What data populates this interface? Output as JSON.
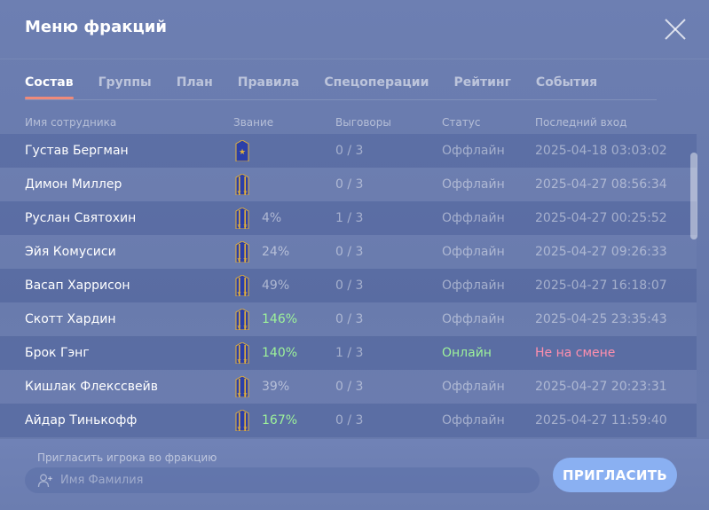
{
  "window": {
    "title": "Меню фракций"
  },
  "tabs": [
    {
      "label": "Состав",
      "active": true
    },
    {
      "label": "Группы",
      "active": false
    },
    {
      "label": "План",
      "active": false
    },
    {
      "label": "Правила",
      "active": false
    },
    {
      "label": "Спецоперации",
      "active": false
    },
    {
      "label": "Рейтинг",
      "active": false
    },
    {
      "label": "События",
      "active": false
    }
  ],
  "columns": {
    "name": "Имя сотрудника",
    "rank": "Звание",
    "warnings": "Выговоры",
    "status": "Статус",
    "last_login": "Последний вход"
  },
  "rank_icons": {
    "1": "epaulette-1-star-icon",
    "2": "epaulette-2-star-icon"
  },
  "rows": [
    {
      "name": "Густав Бергман",
      "rank_stars": 1,
      "percent": "",
      "percent_high": false,
      "warnings": "0 / 3",
      "status": "Оффлайн",
      "online": false,
      "last_login": "2025-04-18 03:03:02",
      "alert": false
    },
    {
      "name": "Димон Миллер",
      "rank_stars": 2,
      "percent": "",
      "percent_high": false,
      "warnings": "0 / 3",
      "status": "Оффлайн",
      "online": false,
      "last_login": "2025-04-27 08:56:34",
      "alert": false
    },
    {
      "name": "Руслан Святохин",
      "rank_stars": 2,
      "percent": "4%",
      "percent_high": false,
      "warnings": "1 / 3",
      "status": "Оффлайн",
      "online": false,
      "last_login": "2025-04-27 00:25:52",
      "alert": false
    },
    {
      "name": "Эйя Комусиси",
      "rank_stars": 2,
      "percent": "24%",
      "percent_high": false,
      "warnings": "0 / 3",
      "status": "Оффлайн",
      "online": false,
      "last_login": "2025-04-27 09:26:33",
      "alert": false
    },
    {
      "name": "Васап Харрисон",
      "rank_stars": 2,
      "percent": "49%",
      "percent_high": false,
      "warnings": "0 / 3",
      "status": "Оффлайн",
      "online": false,
      "last_login": "2025-04-27 16:18:07",
      "alert": false
    },
    {
      "name": "Скотт Хардин",
      "rank_stars": 2,
      "percent": "146%",
      "percent_high": true,
      "warnings": "0 / 3",
      "status": "Оффлайн",
      "online": false,
      "last_login": "2025-04-25 23:35:43",
      "alert": false
    },
    {
      "name": "Брок Гэнг",
      "rank_stars": 2,
      "percent": "140%",
      "percent_high": true,
      "warnings": "1 / 3",
      "status": "Онлайн",
      "online": true,
      "last_login": "Не на смене",
      "alert": true
    },
    {
      "name": "Кишлак Флекссвейв",
      "rank_stars": 2,
      "percent": "39%",
      "percent_high": false,
      "warnings": "0 / 3",
      "status": "Оффлайн",
      "online": false,
      "last_login": "2025-04-27 20:23:31",
      "alert": false
    },
    {
      "name": "Айдар Тинькофф",
      "rank_stars": 2,
      "percent": "167%",
      "percent_high": true,
      "warnings": "0 / 3",
      "status": "Оффлайн",
      "online": false,
      "last_login": "2025-04-27 11:59:40",
      "alert": false
    }
  ],
  "invite": {
    "label": "Пригласить игрока во фракцию",
    "placeholder": "Имя Фамилия",
    "value": "",
    "button_label": "ПРИГЛАСИТЬ"
  },
  "colors": {
    "accent_tab_underline": "#ee8a7a",
    "online": "#9df29a",
    "alert": "#ff8fae",
    "invite_button": "#8ab0f2",
    "epaulette_fill": "#2b3fa8",
    "epaulette_stripe": "#e3b13a"
  }
}
